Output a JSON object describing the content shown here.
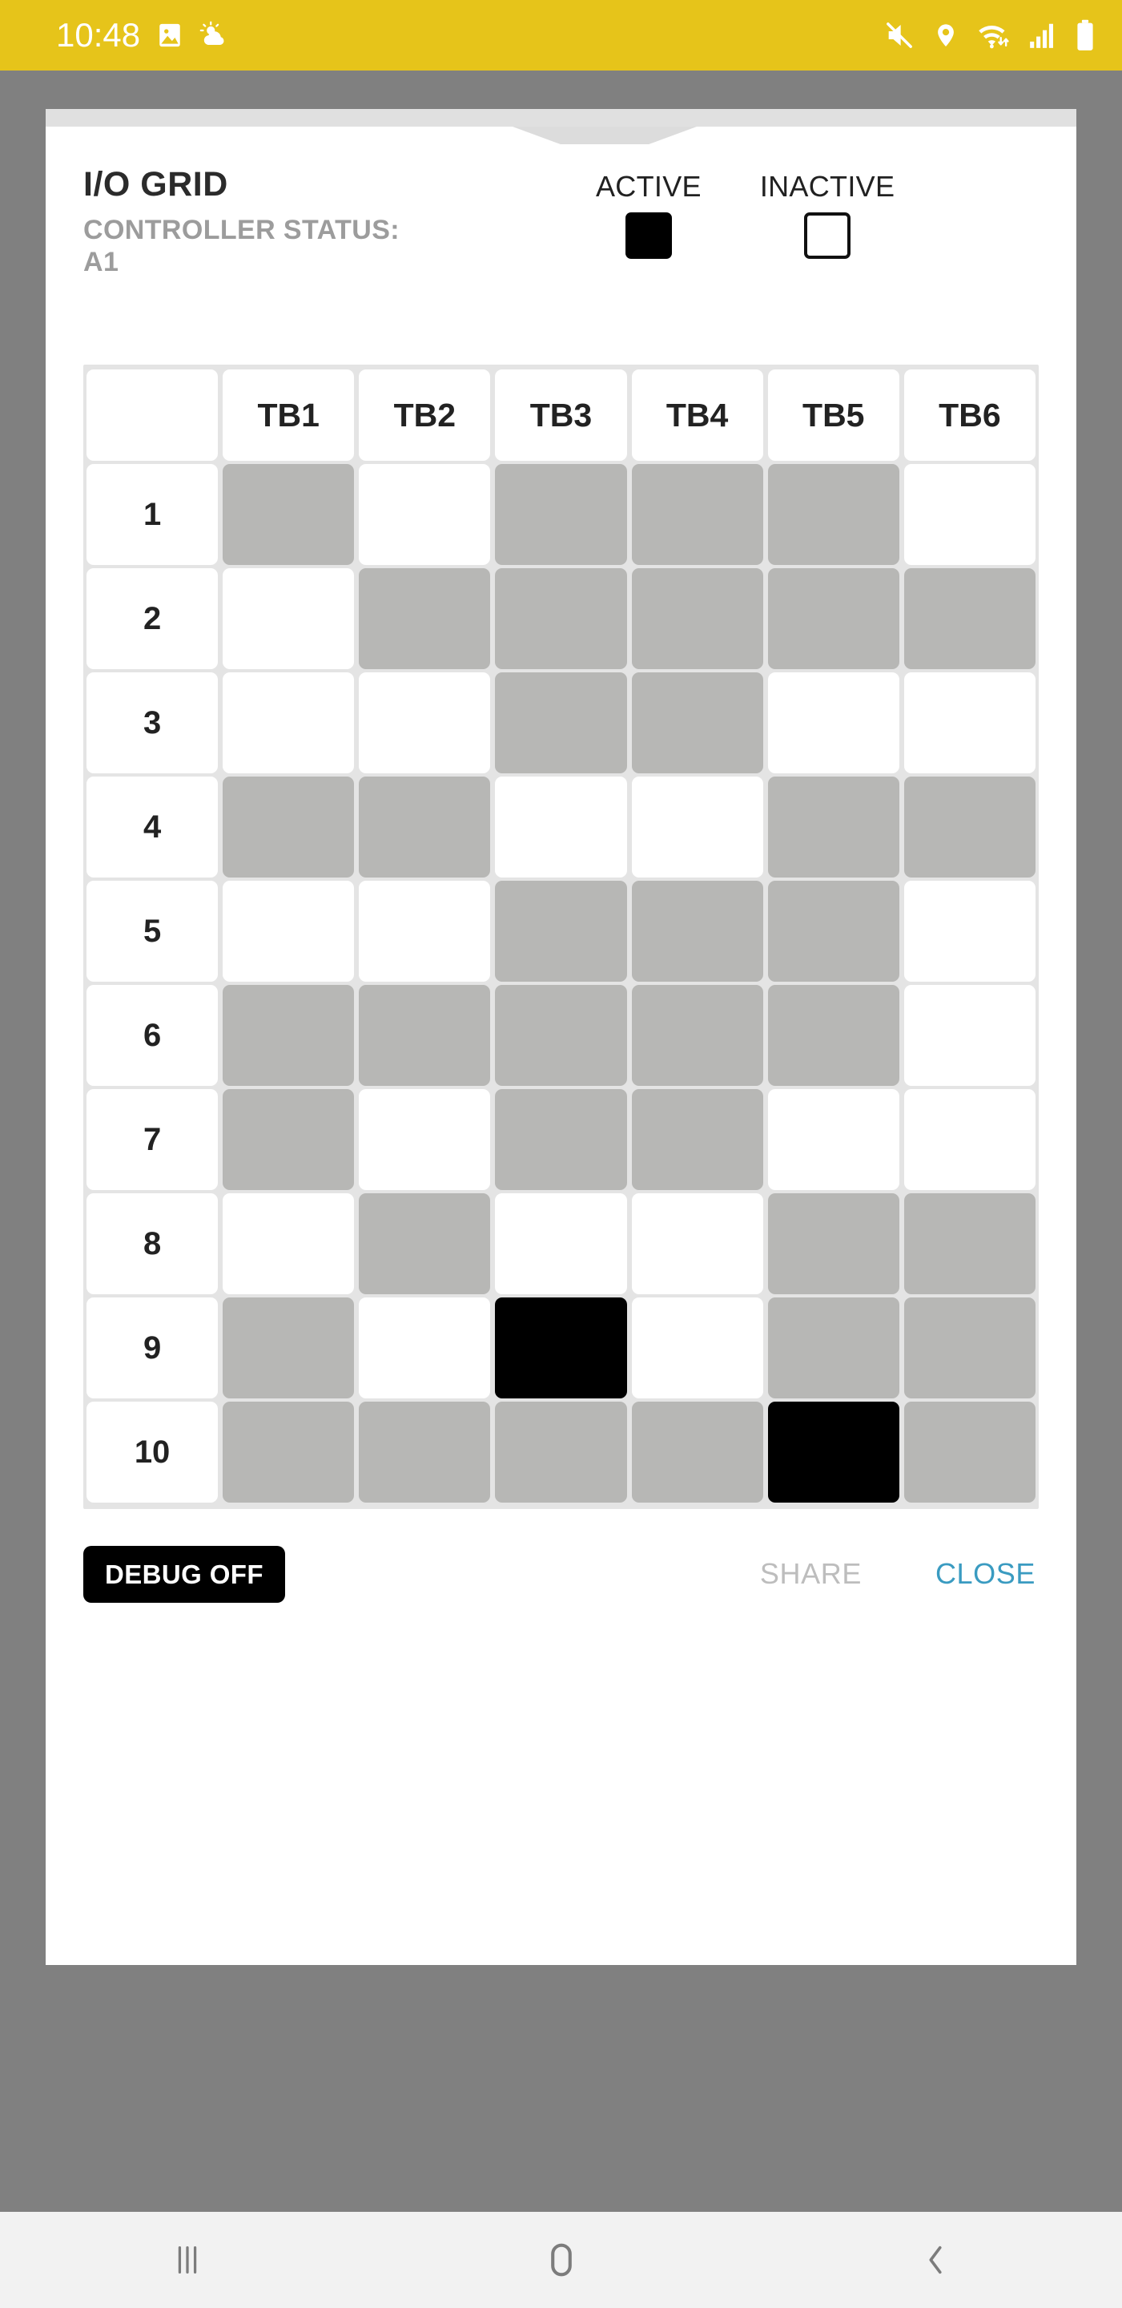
{
  "status_bar": {
    "clock": "10:48",
    "left_icons": [
      "image-icon",
      "weather-icon"
    ],
    "right_icons": [
      "mute-icon",
      "location-icon",
      "wifi-icon",
      "signal-icon",
      "battery-icon"
    ],
    "background_color": "#E6C41A",
    "foreground_color": "#FFFFFF"
  },
  "card": {
    "title": "I/O GRID",
    "status_line_1": "CONTROLLER STATUS:",
    "status_line_2": "A1",
    "legend": [
      {
        "label": "ACTIVE",
        "state": "active",
        "color": "#000000"
      },
      {
        "label": "INACTIVE",
        "state": "inactive",
        "color": "#FFFFFF"
      }
    ]
  },
  "grid": {
    "column_headers": [
      "",
      "TB1",
      "TB2",
      "TB3",
      "TB4",
      "TB5",
      "TB6"
    ],
    "row_labels": [
      "1",
      "2",
      "3",
      "4",
      "5",
      "6",
      "7",
      "8",
      "9",
      "10"
    ],
    "cell_states": [
      [
        "mid",
        "inactive",
        "mid",
        "mid",
        "mid",
        "inactive"
      ],
      [
        "inactive",
        "mid",
        "mid",
        "mid",
        "mid",
        "mid"
      ],
      [
        "inactive",
        "inactive",
        "mid",
        "mid",
        "inactive",
        "inactive"
      ],
      [
        "mid",
        "mid",
        "inactive",
        "inactive",
        "mid",
        "mid"
      ],
      [
        "inactive",
        "inactive",
        "mid",
        "mid",
        "mid",
        "inactive"
      ],
      [
        "mid",
        "mid",
        "mid",
        "mid",
        "mid",
        "inactive"
      ],
      [
        "mid",
        "inactive",
        "mid",
        "mid",
        "inactive",
        "inactive"
      ],
      [
        "inactive",
        "mid",
        "inactive",
        "inactive",
        "mid",
        "mid"
      ],
      [
        "mid",
        "inactive",
        "active",
        "inactive",
        "mid",
        "mid"
      ],
      [
        "mid",
        "mid",
        "mid",
        "mid",
        "active",
        "mid"
      ]
    ],
    "colors": {
      "inactive": "#FFFFFF",
      "mid": "#B7B7B5",
      "active": "#000000",
      "gutter": "#E4E4E4"
    }
  },
  "actions": {
    "debug_label": "DEBUG OFF",
    "share_label": "SHARE",
    "close_label": "CLOSE",
    "close_color": "#3A9BC1",
    "share_color": "#BDBDBD"
  },
  "nav_bar": {
    "items": [
      {
        "name": "recents-icon"
      },
      {
        "name": "home-icon"
      },
      {
        "name": "back-icon"
      }
    ]
  }
}
